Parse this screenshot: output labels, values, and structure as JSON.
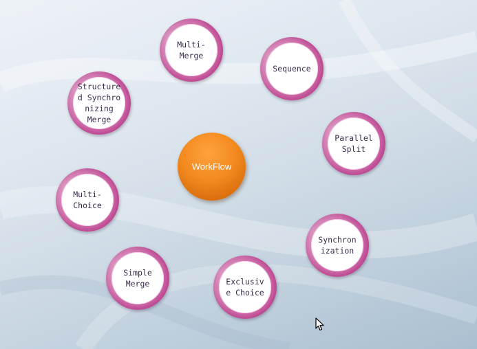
{
  "diagram": {
    "center": {
      "label": "WorkFlow",
      "color": "#f28a1f"
    },
    "ring_color": "#c45c9f",
    "nodes": [
      {
        "id": "multi-merge",
        "label": "Multi-\nMerge"
      },
      {
        "id": "sequence",
        "label": "Sequence"
      },
      {
        "id": "structured-synchronizing-merge",
        "label": "Structure\nd Synchro\nnizing\nMerge"
      },
      {
        "id": "parallel-split",
        "label": "Parallel\nSplit"
      },
      {
        "id": "multi-choice",
        "label": "Multi-\nChoice"
      },
      {
        "id": "synchronization",
        "label": "Synchron\nization"
      },
      {
        "id": "simple-merge",
        "label": "Simple\nMerge"
      },
      {
        "id": "exclusive-choice",
        "label": "Exclusiv\ne Choice"
      }
    ]
  }
}
